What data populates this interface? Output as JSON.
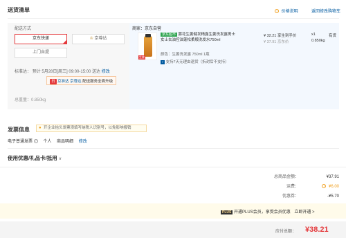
{
  "header": {
    "title": "送货清单",
    "price_note": "价格说明",
    "edit_cart": "返回修改购物车"
  },
  "shipping": {
    "method_label": "配送方式",
    "options": [
      "京东快递",
      "京尊达",
      "上门自提"
    ],
    "schedule_label": "标准达：",
    "schedule_text": "预计 5月28日[周三] 09:00-15:00 送达",
    "schedule_edit": "修改",
    "upgrade_tags": [
      "京准达",
      "京尊达",
      "配送服务全面升级"
    ],
    "weight_label": "总重量：",
    "weight_value": "0.850kg"
  },
  "product": {
    "seller_label": "商家：",
    "seller_name": "京东自营",
    "badge": "京东超市",
    "name_line1": "膝花生姜健发精露生姜洗发露男士",
    "name_line2": "女士去油控油蓬松柔顺洗发水750ml",
    "price": "¥ 32.21",
    "price_suffix": "享生到手价",
    "original_price": "¥ 37.91",
    "original_suffix": "京东价",
    "qty": "x1",
    "stock": "有货",
    "weight": "0.850kg",
    "color_label": "颜色：",
    "color_value": "生姜洗发露 750ml 1瓶",
    "return_policy": "支持7天无理由退货（拆封后不支持）",
    "thumb_text": "生姜"
  },
  "invoice": {
    "title": "发票信息",
    "tip": "开企业抬头发票须填写纳税人识别号，以免影响报销",
    "type": "电子普通发票",
    "holder": "个人",
    "content": "商品明细",
    "edit": "修改"
  },
  "coupon": {
    "title": "使用优惠/礼品卡/抵用",
    "chevron": "∨"
  },
  "summary": {
    "rows": [
      {
        "label": "总商品金额：",
        "value": "¥37.91"
      },
      {
        "label": "运费：",
        "value": "¥6.00"
      },
      {
        "label": "优惠券：",
        "value": "-¥5.70"
      }
    ]
  },
  "plus": {
    "badge": "PLUS",
    "text": "开通PLUS会员，享受会员优惠",
    "link": "立即开通 >"
  },
  "payment": {
    "label": "应付总额：",
    "amount": "¥38.21"
  },
  "colors": {
    "accent_red": "#e4393c",
    "link_blue": "#005aa0",
    "jd_green": "#2ea44f"
  }
}
